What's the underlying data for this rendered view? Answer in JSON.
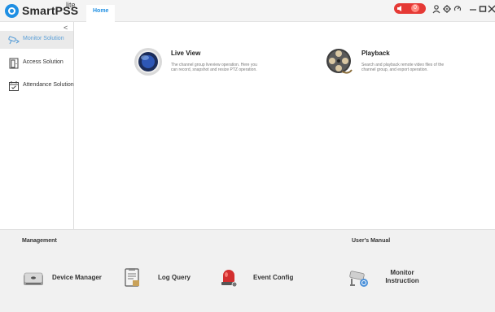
{
  "titlebar": {
    "app_name": "SmartPSS",
    "app_suffix": "lite",
    "home_tab": "Home",
    "alarm_count": "0",
    "colors": {
      "accent": "#1f8fe3",
      "alarm": "#e53935"
    }
  },
  "sidebar": {
    "collapse_glyph": "<",
    "items": [
      {
        "label": "Monitor Solution",
        "icon": "monitor-solution-icon",
        "active": true
      },
      {
        "label": "Access Solution",
        "icon": "access-solution-icon",
        "active": false
      },
      {
        "label": "Attendance Solution",
        "icon": "attendance-solution-icon",
        "active": false
      }
    ]
  },
  "main": {
    "features": [
      {
        "title": "Live View",
        "icon": "live-view-icon",
        "description": "The channel group liveview operation. Here you can record, snapshot and resize PTZ operation."
      },
      {
        "title": "Playback",
        "icon": "playback-icon",
        "description": "Search and playback remote video files of the channel group, and export operation."
      }
    ]
  },
  "bottom": {
    "management_title": "Management",
    "manual_title": "User's Manual",
    "tools": [
      {
        "label": "Device Manager",
        "icon": "device-manager-icon"
      },
      {
        "label": "Log Query",
        "icon": "log-query-icon"
      },
      {
        "label": "Event Config",
        "icon": "event-config-icon"
      }
    ],
    "manual_item": {
      "line1": "Monitor",
      "line2": "Instruction",
      "icon": "monitor-instruction-icon"
    }
  }
}
